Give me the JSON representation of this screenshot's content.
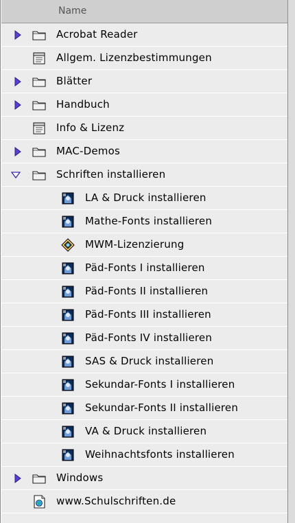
{
  "header": {
    "column_name": "Name"
  },
  "rows": [
    {
      "label": "Acrobat Reader",
      "icon": "folder-icon",
      "expander": "closed",
      "indent": 0
    },
    {
      "label": "Allgem. Lizenzbestimmungen",
      "icon": "document-icon",
      "expander": "none",
      "indent": 0
    },
    {
      "label": "Blätter",
      "icon": "folder-icon",
      "expander": "closed",
      "indent": 0
    },
    {
      "label": "Handbuch",
      "icon": "folder-icon",
      "expander": "closed",
      "indent": 0
    },
    {
      "label": "Info & Lizenz",
      "icon": "document-icon",
      "expander": "none",
      "indent": 0
    },
    {
      "label": "MAC-Demos",
      "icon": "folder-icon",
      "expander": "closed",
      "indent": 0
    },
    {
      "label": "Schriften installieren",
      "icon": "folder-icon",
      "expander": "open",
      "indent": 0
    },
    {
      "label": "LA & Druck installieren",
      "icon": "installer-icon",
      "expander": "none",
      "indent": 1
    },
    {
      "label": "Mathe-Fonts installieren",
      "icon": "installer-icon",
      "expander": "none",
      "indent": 1
    },
    {
      "label": "MWM-Lizenzierung",
      "icon": "app-icon",
      "expander": "none",
      "indent": 1
    },
    {
      "label": "Päd-Fonts I installieren",
      "icon": "installer-icon",
      "expander": "none",
      "indent": 1
    },
    {
      "label": "Päd-Fonts II installieren",
      "icon": "installer-icon",
      "expander": "none",
      "indent": 1
    },
    {
      "label": "Päd-Fonts III  installieren",
      "icon": "installer-icon",
      "expander": "none",
      "indent": 1
    },
    {
      "label": "Päd-Fonts IV installieren",
      "icon": "installer-icon",
      "expander": "none",
      "indent": 1
    },
    {
      "label": "SAS & Druck installieren",
      "icon": "installer-icon",
      "expander": "none",
      "indent": 1
    },
    {
      "label": "Sekundar-Fonts I installieren",
      "icon": "installer-icon",
      "expander": "none",
      "indent": 1
    },
    {
      "label": "Sekundar-Fonts II installieren",
      "icon": "installer-icon",
      "expander": "none",
      "indent": 1
    },
    {
      "label": "VA & Druck installieren",
      "icon": "installer-icon",
      "expander": "none",
      "indent": 1
    },
    {
      "label": "Weihnachtsfonts installieren",
      "icon": "installer-icon",
      "expander": "none",
      "indent": 1
    },
    {
      "label": "Windows",
      "icon": "folder-icon",
      "expander": "closed",
      "indent": 0
    },
    {
      "label": "www.Schulschriften.de",
      "icon": "web-document-icon",
      "expander": "none",
      "indent": 0
    }
  ],
  "colors": {
    "header_bg": "#cfcfcf",
    "row_bg": "#ececec",
    "expander": "#5b3fd1",
    "folder_blue": "#7b7bff"
  }
}
